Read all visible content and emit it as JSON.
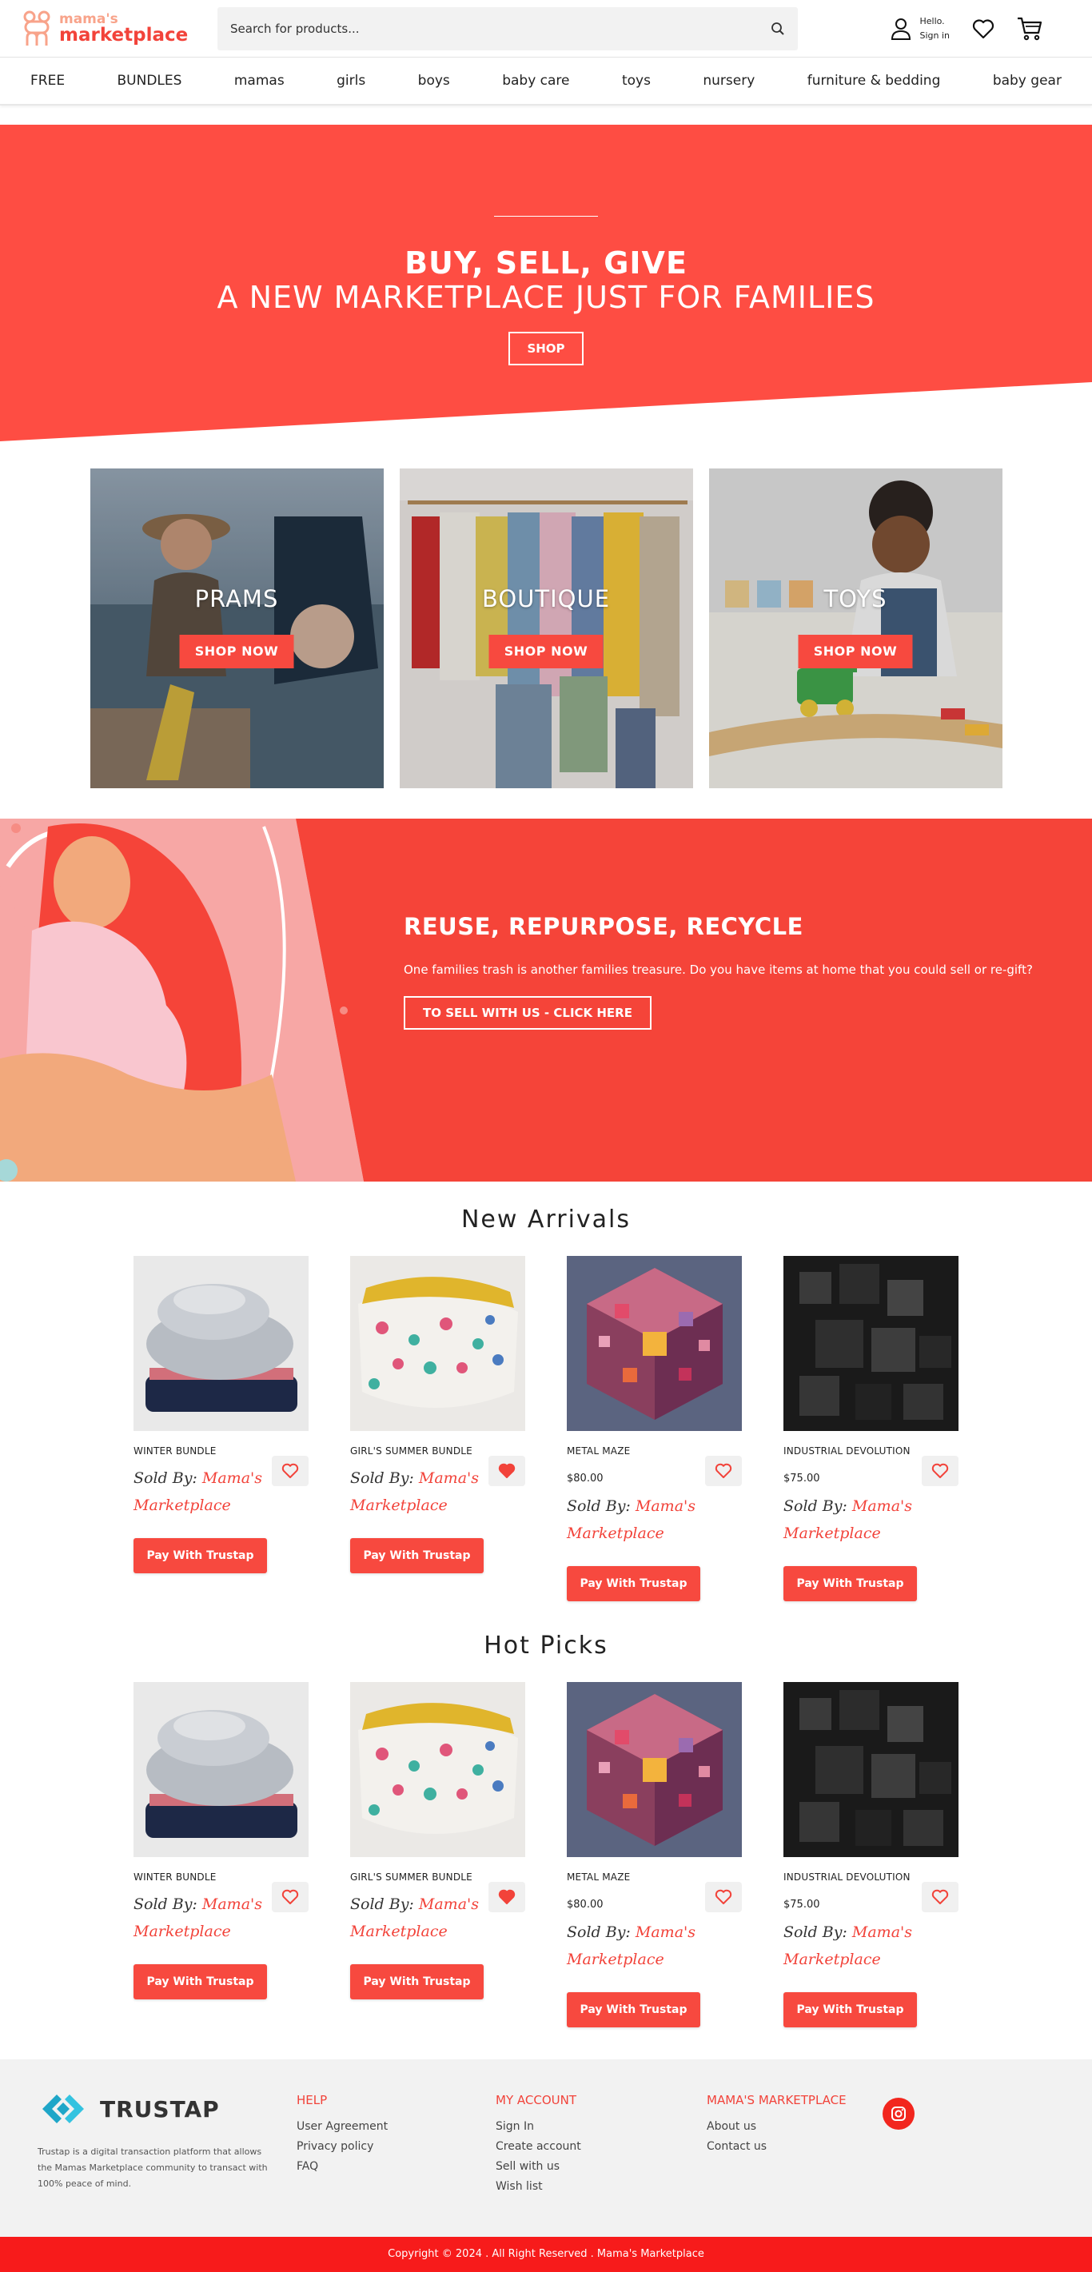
{
  "header": {
    "logo_line1": "mama's",
    "logo_line2": "marketplace",
    "search_placeholder": "Search for products...",
    "greeting": "Hello.",
    "sign_in": "Sign in",
    "icons": [
      "search-icon",
      "user-icon",
      "heart-icon",
      "cart-icon"
    ]
  },
  "nav": {
    "items": [
      "FREE",
      "BUNDLES",
      "mamas",
      "girls",
      "boys",
      "baby care",
      "toys",
      "nursery",
      "furniture & bedding",
      "baby gear"
    ]
  },
  "hero": {
    "line1": "BUY, SELL, GIVE",
    "line2": "A NEW MARKETPLACE JUST FOR FAMILIES",
    "button": "SHOP"
  },
  "tiles": [
    {
      "label": "PRAMS",
      "button": "SHOP NOW"
    },
    {
      "label": "BOUTIQUE",
      "button": "SHOP NOW"
    },
    {
      "label": "TOYS",
      "button": "SHOP NOW"
    }
  ],
  "promo": {
    "title": "REUSE, REPURPOSE, RECYCLE",
    "text": "One families trash is another families treasure.  Do you have items at home that you could sell or re-gift?",
    "button": "TO SELL WITH US - CLICK HERE"
  },
  "new_arrivals": {
    "title": "New Arrivals",
    "products": [
      {
        "name": "WINTER BUNDLE",
        "price": "",
        "sold_by": "Sold By:",
        "seller": "Mama's Marketplace",
        "button": "Pay With Trustap",
        "favorited": false
      },
      {
        "name": "GIRL'S SUMMER BUNDLE",
        "price": "",
        "sold_by": "Sold By:",
        "seller": "Mama's Marketplace",
        "button": "Pay With Trustap",
        "favorited": true
      },
      {
        "name": "METAL MAZE",
        "price": "$80.00",
        "sold_by": "Sold By:",
        "seller": "Mama's Marketplace",
        "button": "Pay With Trustap",
        "favorited": false
      },
      {
        "name": "INDUSTRIAL DEVOLUTION",
        "price": "$75.00",
        "sold_by": "Sold By:",
        "seller": "Mama's Marketplace",
        "button": "Pay With Trustap",
        "favorited": false
      }
    ]
  },
  "hot_picks": {
    "title": "Hot Picks",
    "products": [
      {
        "name": "WINTER BUNDLE",
        "price": "",
        "sold_by": "Sold By:",
        "seller": "Mama's Marketplace",
        "button": "Pay With Trustap",
        "favorited": false
      },
      {
        "name": "GIRL'S SUMMER BUNDLE",
        "price": "",
        "sold_by": "Sold By:",
        "seller": "Mama's Marketplace",
        "button": "Pay With Trustap",
        "favorited": true
      },
      {
        "name": "METAL MAZE",
        "price": "$80.00",
        "sold_by": "Sold By:",
        "seller": "Mama's Marketplace",
        "button": "Pay With Trustap",
        "favorited": false
      },
      {
        "name": "INDUSTRIAL DEVOLUTION",
        "price": "$75.00",
        "sold_by": "Sold By:",
        "seller": "Mama's Marketplace",
        "button": "Pay With Trustap",
        "favorited": false
      }
    ]
  },
  "footer": {
    "brand": "TRUSTAP",
    "description": "Trustap is a digital transaction platform that allows the Mamas Marketplace community to transact with 100% peace of mind.",
    "columns": [
      {
        "title": "HELP",
        "links": [
          "User Agreement",
          "Privacy policy",
          "FAQ"
        ]
      },
      {
        "title": "MY ACCOUNT",
        "links": [
          "Sign In",
          "Create account",
          "Sell with us",
          "Wish list"
        ]
      },
      {
        "title": "MAMA'S MARKETPLACE",
        "links": [
          "About us",
          "Contact us"
        ]
      }
    ],
    "copyright": "Copyright © 2024 . All Right Reserved . Mama's Marketplace"
  },
  "colors": {
    "accent": "#f2433a",
    "hero": "#fe4d43",
    "copyright_bar": "#f71b1b"
  }
}
